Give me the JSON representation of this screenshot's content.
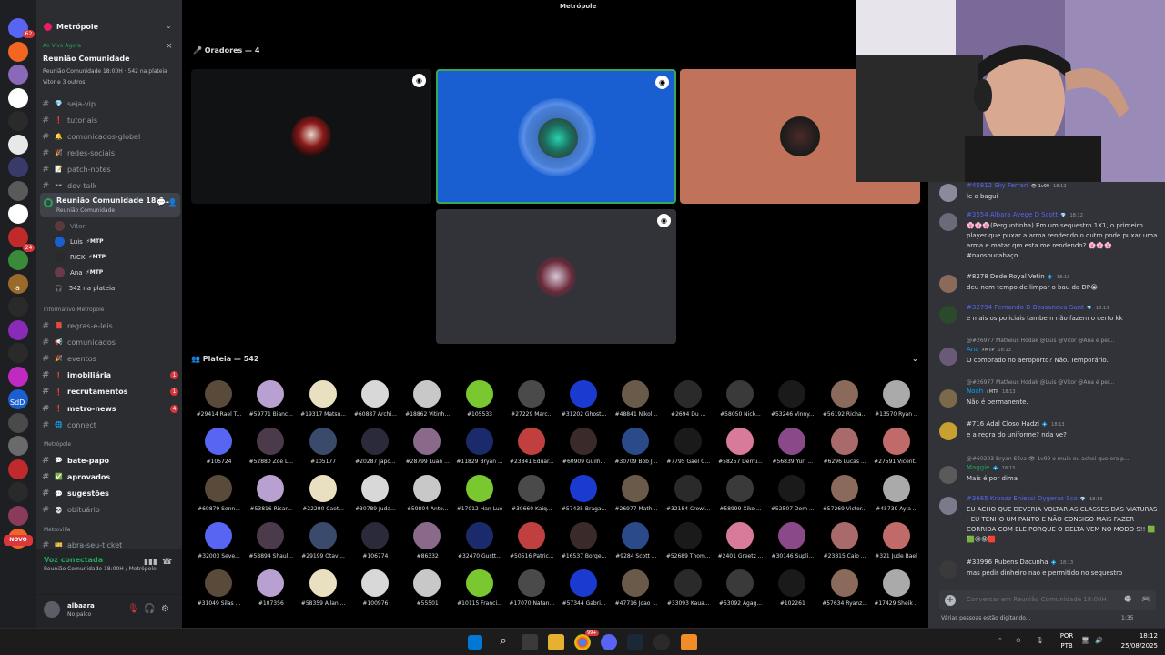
{
  "server": {
    "name": "Metrópole",
    "live": {
      "tag": "Ao Vivo Agora",
      "title": "Reunião Comunidade",
      "subtitle": "Reunião Comunidade 18:00H · 542 na plateia",
      "users": "Vitor e 3 outros"
    }
  },
  "channels_top": [
    {
      "name": "seja-vip",
      "emoji": "💎"
    },
    {
      "name": "tutoriais",
      "emoji": "❗"
    },
    {
      "name": "comunicados-global",
      "emoji": "🔔"
    },
    {
      "name": "redes-sociais",
      "emoji": "🎉"
    },
    {
      "name": "patch-notes",
      "emoji": "📝"
    },
    {
      "name": "dev-talk",
      "emoji": "👓"
    }
  ],
  "stage_channel": {
    "title": "Reunião Comunidade 18:0...",
    "subtitle": "Reunião Comunidade",
    "speakers": [
      {
        "name": "Vitor",
        "tag": "",
        "dim": true
      },
      {
        "name": "Luis",
        "tag": "⚡MTP",
        "dim": false
      },
      {
        "name": "RICK",
        "tag": "⚡MTP",
        "dim": false
      },
      {
        "name": "Ana",
        "tag": "⚡MTP",
        "dim": false
      }
    ],
    "audience_count": "542 na plateia"
  },
  "category_info": "Informativo Metrópole",
  "channels_info": [
    {
      "name": "regras-e-leis",
      "emoji": "📕",
      "bold": false,
      "badge": ""
    },
    {
      "name": "comunicados",
      "emoji": "📢",
      "bold": false,
      "badge": ""
    },
    {
      "name": "eventos",
      "emoji": "🎉",
      "bold": false,
      "badge": ""
    },
    {
      "name": "imobiliária",
      "emoji": "",
      "bold": true,
      "badge": "1"
    },
    {
      "name": "recrutamentos",
      "emoji": "",
      "bold": true,
      "badge": "1"
    },
    {
      "name": "metro-news",
      "emoji": "",
      "bold": true,
      "badge": "4"
    },
    {
      "name": "connect",
      "emoji": "🌐",
      "bold": false,
      "badge": ""
    }
  ],
  "category_metro": "Metrópole",
  "channels_metro": [
    {
      "name": "bate-papo",
      "emoji": "💬",
      "bold": true
    },
    {
      "name": "aprovados",
      "emoji": "✅",
      "bold": true
    },
    {
      "name": "sugestões",
      "emoji": "💬",
      "bold": true
    },
    {
      "name": "obituário",
      "emoji": "💀",
      "bold": false
    }
  ],
  "category_metrovilla": "Metrovilla",
  "channel_last": "abra-seu-ticket",
  "voice": {
    "title": "Voz conectada",
    "subtitle": "Reunião Comunidade 18:00H / Metrópole"
  },
  "user": {
    "name": "albaara",
    "status": "No palco"
  },
  "rail_new": "NOVO",
  "rail_badges": [
    "62",
    "24"
  ],
  "rail_labels": [
    "a",
    "SdD"
  ],
  "stage": {
    "top_title": "Metrópole",
    "speakers_header": "Oradores — 4",
    "audience_header": "Plateia — 542"
  },
  "audience": [
    "#29414 Rael T...",
    "#59771 Bianc...",
    "#19317 Matsu...",
    "#60887 Archi...",
    "#18862 Vitinh...",
    "#105533",
    "#27229 Marc...",
    "#31202 Ghost...",
    "#48841 Nikol...",
    "#2694 Du ...",
    "#58050 Nick...",
    "#53246 Vinny...",
    "#56192 Richa...",
    "#13570 Ryan ...",
    "#105724",
    "#52880 Zoe L...",
    "#105177",
    "#20287 Japo...",
    "#28799 Luan ...",
    "#11829 Bryan ...",
    "#23841 Eduar...",
    "#60909 Guilh...",
    "#30709 Bob J...",
    "#7795 Gael C...",
    "#58257 Derru...",
    "#56839 Yuri ...",
    "#6296 Lucas ...",
    "#27591 Vicent...",
    "#60879 Senn...",
    "#53816 Ricar...",
    "#22290 Caet...",
    "#30789 Juda...",
    "#59804 Anto...",
    "#17012 Han Lue",
    "#30660 Kaiq...",
    "#57435 Braga...",
    "#26977 Math...",
    "#32184 Crowl...",
    "#58999 Xiko ...",
    "#52507 Dom ...",
    "#57269 Victor...",
    "#45739 Ayla ...",
    "#32003 Seve...",
    "#58894 Shaul...",
    "#29199 Otavi...",
    "#106774",
    "#86332",
    "#32470 Gustt...",
    "#50516 Patric...",
    "#16537 Borge...",
    "#9284 Scott ...",
    "#52689 Thom...",
    "#2401 Greetz ...",
    "#30146 Supli...",
    "#23815 Caio ...",
    "#321 Jude Baek",
    "#31049 Silas ...",
    "#107356",
    "#58359 Allan ...",
    "#100976",
    "#55501",
    "#10115 Franci...",
    "#17070 Natan...",
    "#57344 Gabri...",
    "#47716 Joao ...",
    "#33093 Kaua...",
    "#53092 Agag...",
    "#102261",
    "#57634 Ryanz...",
    "#17429 Sheik ..."
  ],
  "chat": [
    {
      "author": "#45812 Sky Ferrari",
      "badge": "👁 1v99",
      "time": "18:12",
      "reply": "",
      "text": "le o bagui",
      "color": "#5865f2"
    },
    {
      "author": "#3554 Albara Avege D Scott",
      "badge": "💎",
      "time": "18:12",
      "reply": "",
      "text": "🌸🌸🌸(Perguntinha) Em um  sequestro 1X1, o primeiro player que puxar a arma rendendo o outro pode  puxar uma  arma e matar qm esta me rendendo? 🌸🌸🌸 #naosoucabaço",
      "color": "#5865f2"
    },
    {
      "author": "#8278 Dede Royal Vetin",
      "badge": "💠",
      "time": "18:13",
      "reply": "",
      "text": "deu nem tempo de limpar o bau da DP😭",
      "color": "#dbdee1"
    },
    {
      "author": "#32794 Fernando D Bossanova Sant",
      "badge": "💎",
      "time": "18:13",
      "reply": "",
      "text": "e mais os policiais tambem não fazem o certo kk",
      "color": "#5865f2"
    },
    {
      "author": "Ana",
      "badge": "⚡MTP",
      "time": "18:13",
      "reply": "@#26977 Matheus Hodak @Luis @Vitor @Ana é per...",
      "text": "O comprado no aeroporto? Não. Temporário.",
      "color": "#00a8fc"
    },
    {
      "author": "Noah",
      "badge": "⚡MTP",
      "time": "18:13",
      "reply": "@#26977 Matheus Hodak @Luis @Vitor @Ana é per...",
      "text": "Não é permanente.",
      "color": "#00a8fc"
    },
    {
      "author": "#716 Adal Closo Hadzi",
      "badge": "💠",
      "time": "18:13",
      "reply": "",
      "text": "e a regra do uniforme? nda ve?",
      "color": "#dbdee1"
    },
    {
      "author": "Maggie",
      "badge": "💠",
      "time": "18:13",
      "reply": "@#60203 Bryan Silva 👁 1v99 o muie eu achei que era p...",
      "text": "Mais é por dima",
      "color": "#23a559"
    },
    {
      "author": "#3665 Kroozz Eniessi Dygeras Sco",
      "badge": "💎",
      "time": "18:13",
      "reply": "",
      "text": "EU ACHO QUE DEVERIA VOLTAR AS CLASSES DAS VIATURAS - EU TENHO UM PANTO E NÃO CONSIGO MAIS FAZER CORRIDA COM ELE PORQUE O DELTA VEM NO MODO S!! 🟩🟩😑😡🟥",
      "color": "#5865f2"
    },
    {
      "author": "#33996 Rubens Dacunha",
      "badge": "💠",
      "time": "18:13",
      "reply": "",
      "text": "mas pedir dinheiro nao e permitido no sequestro",
      "color": "#dbdee1"
    }
  ],
  "chat_input": {
    "placeholder": "Conversar em Reunião Comunidade 18:00H"
  },
  "typing": "Várias pessoas estão digitando...",
  "typing_time": "1:35",
  "taskbar": {
    "lang1": "POR",
    "lang2": "PTB",
    "time": "18:12",
    "date": "25/08/2025",
    "chrome_badge": "99+"
  }
}
